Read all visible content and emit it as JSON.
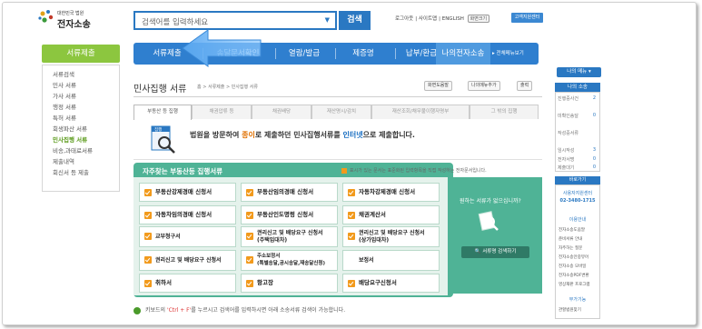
{
  "header": {
    "logo_small": "대한민국 법원",
    "logo_big": "전자소송",
    "search_placeholder": "검색어를 입력하세요",
    "search_button": "검색",
    "links": [
      "로그아웃",
      "사이트맵",
      "ENGLISH"
    ],
    "font_size_label": "화면크기",
    "user_button": "고객지원센터"
  },
  "nav": {
    "items": [
      "서류제출",
      "송달문서확인",
      "열람/발급",
      "제증명",
      "납부/환급",
      "나의전자소송"
    ],
    "all_menu": "▸ 전체메뉴보기"
  },
  "left": {
    "title": "서류제출",
    "items": [
      "서류검색",
      "민사 서류",
      "가사 서류",
      "행정 서류",
      "특허 서류",
      "회생파산 서류",
      "민사집행 서류",
      "비송,과태료서류",
      "제출내역",
      "회신서 등 제출"
    ],
    "selected_index": 6
  },
  "page": {
    "title": "민사집행 서류",
    "breadcrumb": "홈 > 서류제출 > 민사집행 서류",
    "tools": [
      "화면도움말",
      "나의메뉴추가",
      "출력"
    ]
  },
  "tabs": [
    "부동산 등 집행",
    "채권압류 등",
    "채권배당",
    "재산명시/감치",
    "재산조회/채무불이행자명부",
    "그 밖의 집행"
  ],
  "notice": {
    "prefix": "법원을 방문하여 ",
    "paper": "종이",
    "mid": "로 제출하던 민사집행서류를 ",
    "internet": "인터넷",
    "suffix": "으로 제출합니다."
  },
  "panel": {
    "title": "자주찾는 부동산등 집행서류",
    "hint": "표시가 있는 문서는 표준화된 입력항목을 직접 작성하는 전자문서입니다.",
    "docs": [
      [
        "부동산강제경매 신청서",
        "부동산임의경매 신청서",
        "자동차강제경매 신청서"
      ],
      [
        "자동차임의경매 신청서",
        "부동산인도명령 신청서",
        "채권계산서"
      ],
      [
        "교부청구서",
        "권리신고 및 배당요구 신청서\n(주택임대차)",
        "권리신고 및 배당요구 신청서\n(상가임대차)"
      ],
      [
        "권리신고 및 배당요구 신청서",
        "주소보정서\n(특별송달,공시송달,재송달신청)",
        "보정서"
      ],
      [
        "취하서",
        "항고장",
        "배당요구신청서"
      ]
    ],
    "question": "원하는 서류가 없으십니까?",
    "search_button": "서류명 검색하기"
  },
  "footer": {
    "prefix": "키보드의 ",
    "keys": "'Ctrl + F'",
    "suffix": "를 누르시고 검색어를 입력하시면 아래 소송서류 검색이 가능합니다."
  },
  "right": {
    "my_menu": "나의 메뉴 ▾",
    "my_case": "나의 소송",
    "items": [
      [
        "진행중사건",
        "2"
      ],
      [
        "미확인송달",
        "0"
      ],
      [
        "작성중서류",
        ""
      ],
      [
        "임시작성",
        "3"
      ],
      [
        "전자서명",
        "0"
      ],
      [
        "제출대기",
        "0"
      ]
    ],
    "shortcuts": "바로가기",
    "center": "사용자지원센터",
    "phone": "02-3480-1715",
    "guide": "이용안내",
    "links": [
      "전자소송도움말",
      "준비서류 안내",
      "자주하는 질문",
      "전자소송안중뷰어",
      "전자소송 모바일",
      "전자소송PDF변환",
      "영상재판 프로그램"
    ],
    "more": "부가기능",
    "more_links": [
      "관할법원찾기"
    ]
  },
  "colors": {
    "brand_blue": "#2f7fcf",
    "green_header": "#8cc63f",
    "panel_green": "#4fb396",
    "check_orange": "#f29a1c"
  }
}
